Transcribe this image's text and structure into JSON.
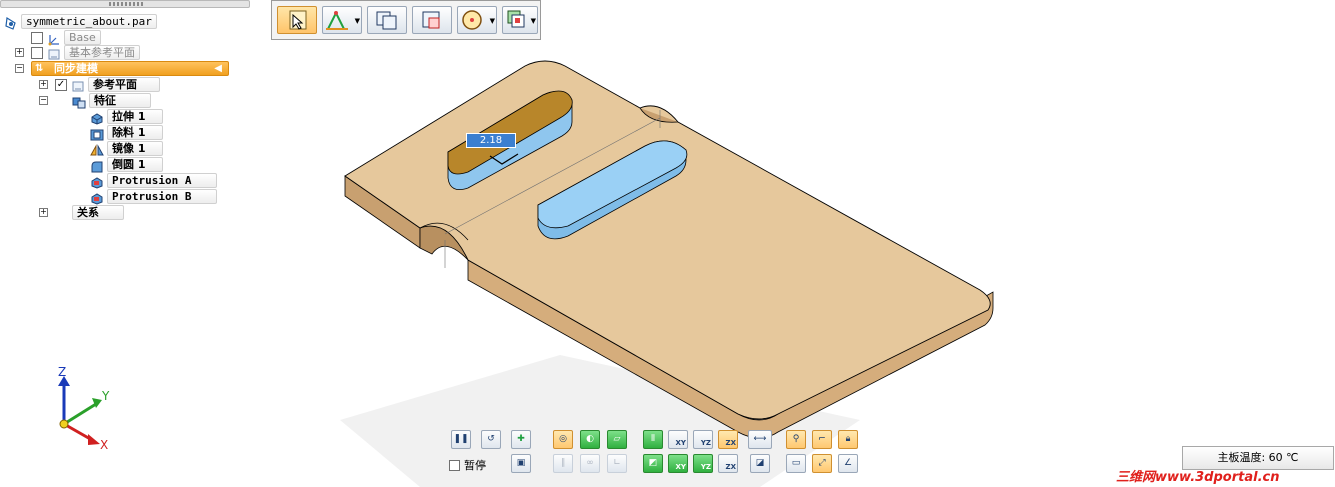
{
  "tree": {
    "root": "symmetric_about.par",
    "base": "Base",
    "base_ref_planes": "基本参考平面",
    "sync_modeling": "同步建模",
    "ref_planes": "参考平面",
    "features": "特征",
    "feature_items": [
      "拉伸 1",
      "除料 1",
      "镜像 1",
      "倒圆 1",
      "Protrusion A",
      "Protrusion B"
    ],
    "relations": "关系"
  },
  "viewport": {
    "dimension_value": "2.18"
  },
  "triad": {
    "x": "X",
    "y": "Y",
    "z": "Z"
  },
  "bottom_toolbar": {
    "pause_label": "暂停",
    "plane_labels": [
      "XY",
      "YZ",
      "ZX"
    ]
  },
  "status": {
    "temperature": "主板温度: 60 ℃"
  },
  "watermark": "三维网www.3dportal.cn",
  "colors": {
    "part_top": "#e6c89c",
    "part_side": "#d9b487",
    "highlight_face": "#9ad0f5",
    "selected_face": "#b8862a",
    "tree_selected": "#f5a623"
  }
}
